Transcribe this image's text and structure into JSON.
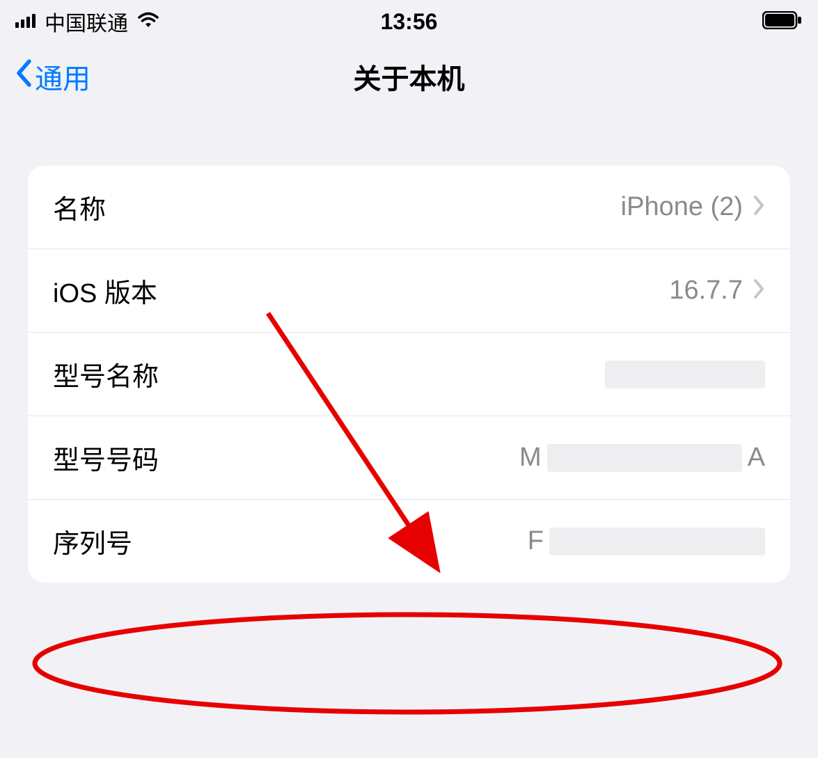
{
  "status_bar": {
    "carrier": "中国联通",
    "time": "13:56"
  },
  "nav": {
    "back_label": "通用",
    "title": "关于本机"
  },
  "rows": {
    "name": {
      "label": "名称",
      "value": "iPhone (2)"
    },
    "ios_version": {
      "label": "iOS 版本",
      "value": "16.7.7"
    },
    "model_name": {
      "label": "型号名称"
    },
    "model_number": {
      "label": "型号号码",
      "prefix": "M",
      "suffix": "A"
    },
    "serial": {
      "label": "序列号",
      "prefix": "F"
    }
  }
}
